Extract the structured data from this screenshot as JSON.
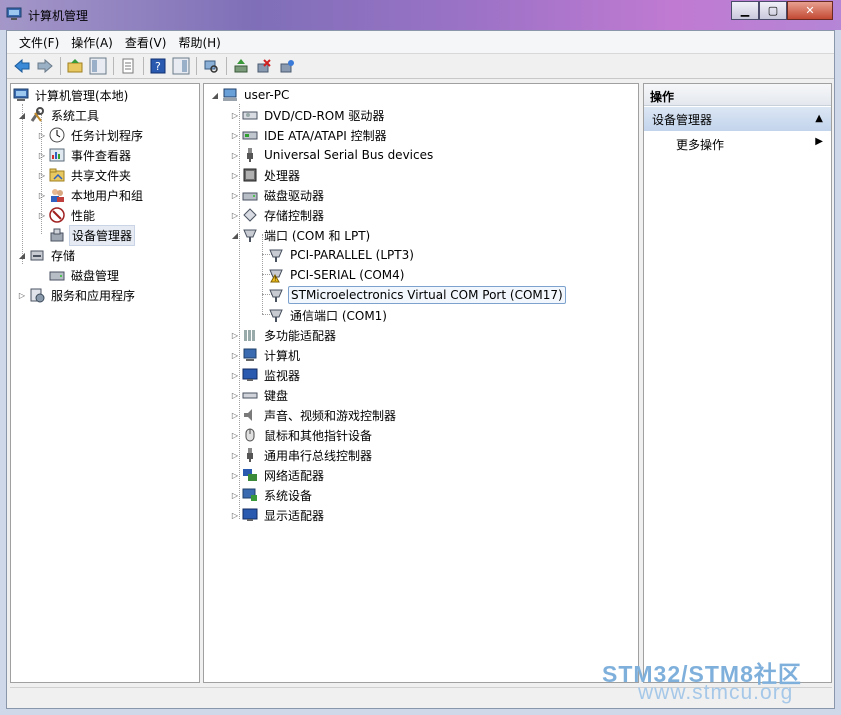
{
  "window": {
    "title": "计算机管理",
    "min": "▁",
    "max": "▢",
    "close": "✕"
  },
  "menu": [
    "文件(F)",
    "操作(A)",
    "查看(V)",
    "帮助(H)"
  ],
  "left_tree": {
    "root": "计算机管理(本地)",
    "system_tools": "系统工具",
    "task_scheduler": "任务计划程序",
    "event_viewer": "事件查看器",
    "shared_folders": "共享文件夹",
    "local_users": "本地用户和组",
    "performance": "性能",
    "device_manager": "设备管理器",
    "storage": "存储",
    "disk_management": "磁盘管理",
    "services": "服务和应用程序"
  },
  "device_tree": {
    "root": "user-PC",
    "items": [
      "DVD/CD-ROM 驱动器",
      "IDE ATA/ATAPI 控制器",
      "Universal Serial Bus devices",
      "处理器",
      "磁盘驱动器",
      "存储控制器",
      "端口 (COM 和 LPT)"
    ],
    "ports": [
      "PCI-PARALLEL (LPT3)",
      "PCI-SERIAL (COM4)",
      "STMicroelectronics Virtual COM Port (COM17)",
      "通信端口 (COM1)"
    ],
    "items_after": [
      "多功能适配器",
      "计算机",
      "监视器",
      "键盘",
      "声音、视频和游戏控制器",
      "鼠标和其他指针设备",
      "通用串行总线控制器",
      "网络适配器",
      "系统设备",
      "显示适配器"
    ]
  },
  "actions": {
    "header": "操作",
    "section": "设备管理器",
    "more": "更多操作"
  },
  "watermark": {
    "line1": "STM32/STM8社区",
    "line2": "www.stmcu.org"
  }
}
